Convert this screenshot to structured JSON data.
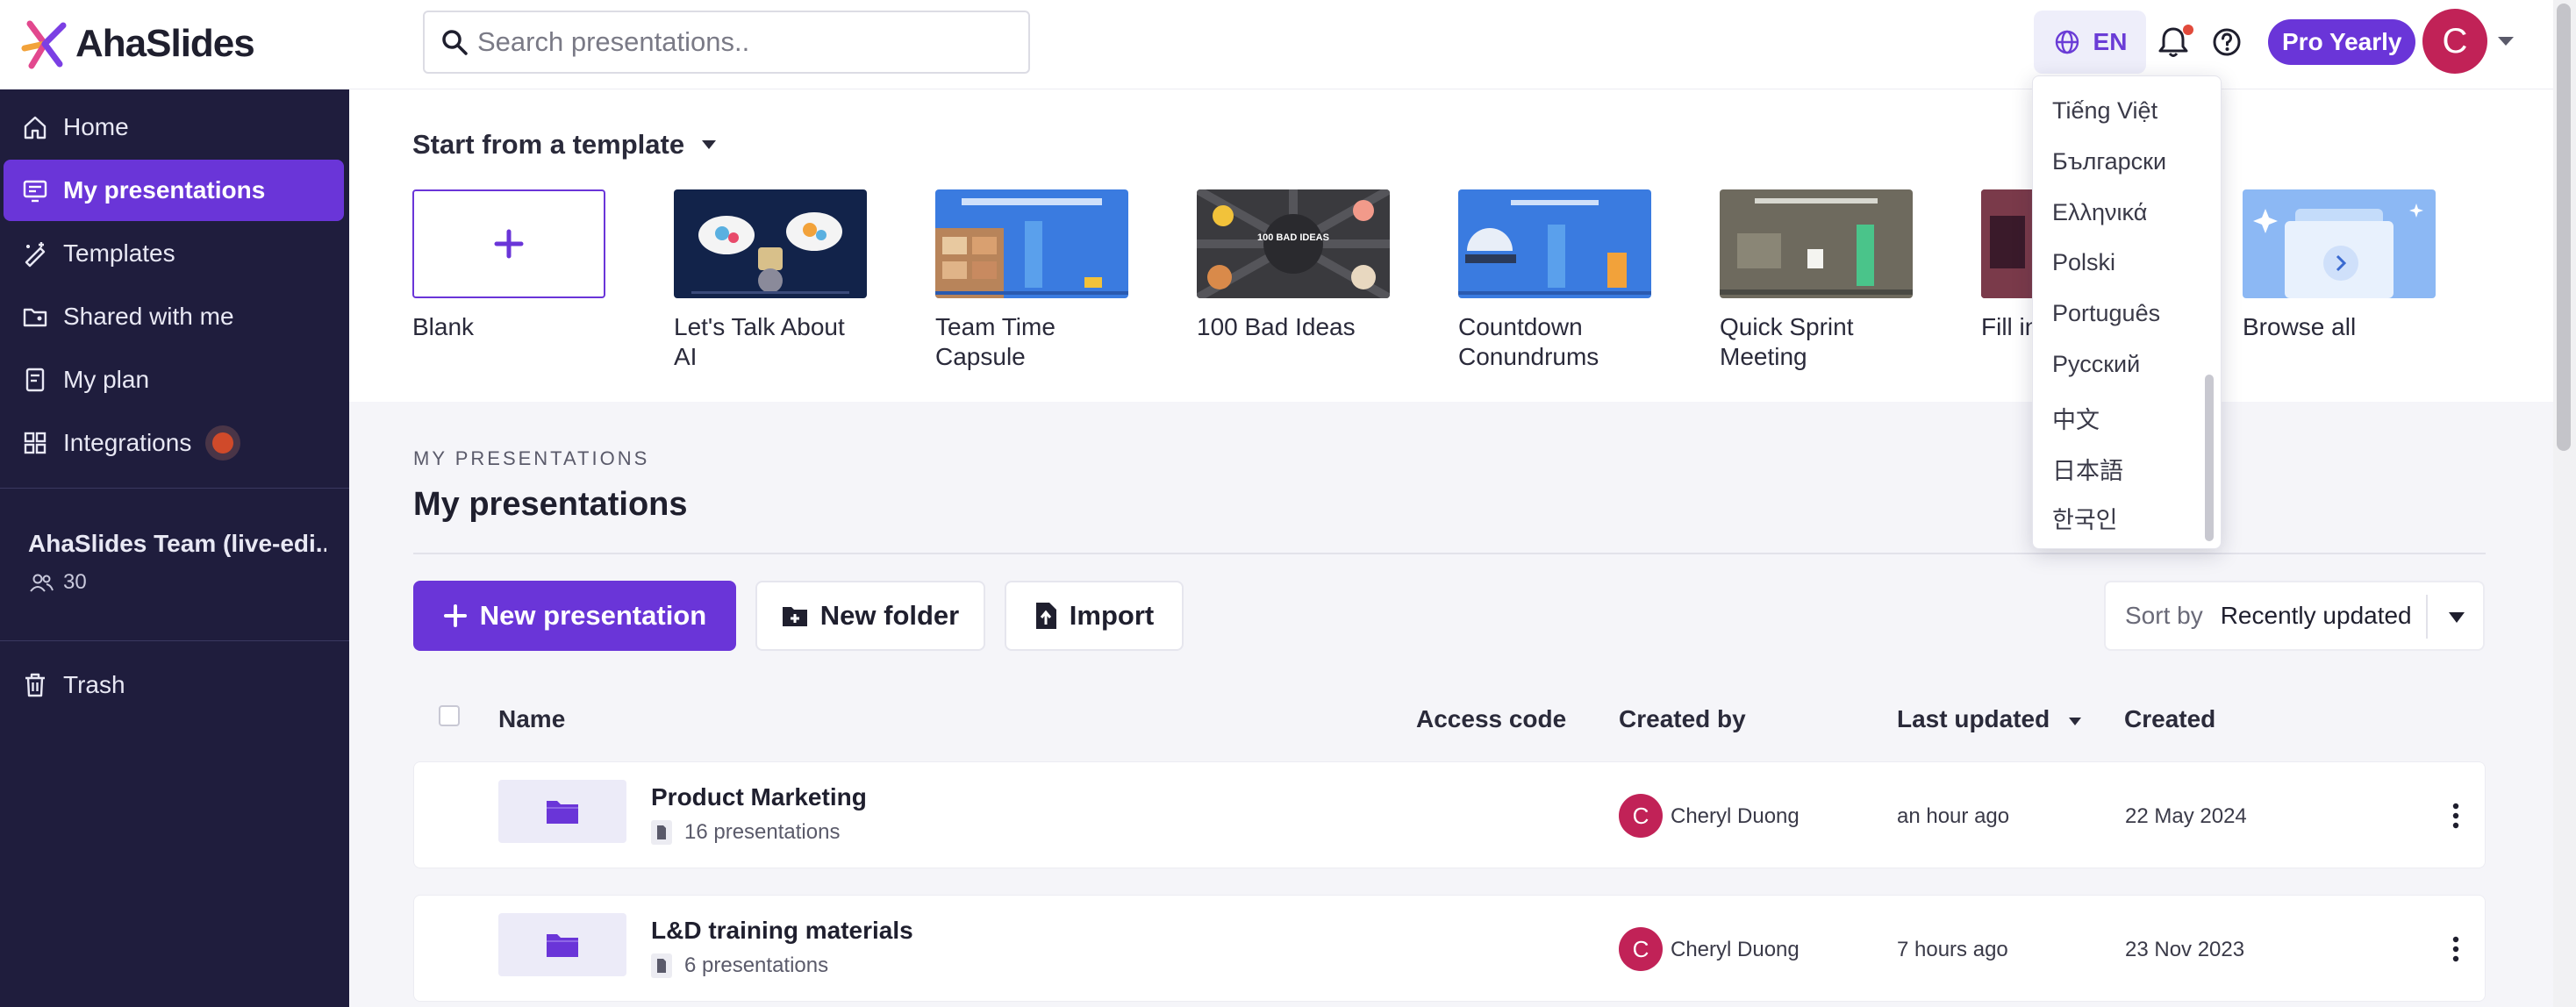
{
  "app": {
    "logo_text": "AhaSlides"
  },
  "search": {
    "placeholder": "Search presentations.."
  },
  "header": {
    "language_code": "EN",
    "plan_badge": "Pro Yearly",
    "avatar_initial": "C",
    "icons": [
      "globe-icon",
      "bell-icon",
      "help-icon",
      "chevron-down-icon"
    ]
  },
  "sidebar": {
    "items": [
      {
        "label": "Home",
        "icon": "home-icon"
      },
      {
        "label": "My presentations",
        "icon": "presentation-icon",
        "active": true
      },
      {
        "label": "Templates",
        "icon": "templates-icon"
      },
      {
        "label": "Shared with me",
        "icon": "shared-folder-icon"
      },
      {
        "label": "My plan",
        "icon": "plan-icon"
      },
      {
        "label": "Integrations",
        "icon": "integrations-icon"
      }
    ],
    "team": {
      "name": "AhaSlides Team (live-edi...",
      "members": "30"
    },
    "trash": {
      "label": "Trash",
      "icon": "trash-icon"
    }
  },
  "templates": {
    "heading": "Start from a template",
    "cards": [
      {
        "label": "Blank"
      },
      {
        "label": "Let's Talk About AI"
      },
      {
        "label": "Team Time Capsule"
      },
      {
        "label": "100 Bad Ideas",
        "thumb_text": "100 BAD IDEAS"
      },
      {
        "label": "Countdown Conundrums"
      },
      {
        "label": "Quick Sprint Meeting"
      },
      {
        "label": "Fill in"
      },
      {
        "label": "Browse all"
      }
    ]
  },
  "main": {
    "eyebrow": "MY PRESENTATIONS",
    "title": "My presentations",
    "buttons": {
      "new_presentation": "New presentation",
      "new_folder": "New folder",
      "import": "Import"
    },
    "sort": {
      "label": "Sort by",
      "value": "Recently updated"
    },
    "columns": {
      "name": "Name",
      "access_code": "Access code",
      "created_by": "Created by",
      "last_updated": "Last updated",
      "created": "Created"
    },
    "rows": [
      {
        "title": "Product Marketing",
        "count": "16 presentations",
        "creator_initial": "C",
        "creator": "Cheryl Duong",
        "updated": "an hour ago",
        "created": "22 May 2024"
      },
      {
        "title": "L&D training materials",
        "count": "6 presentations",
        "creator_initial": "C",
        "creator": "Cheryl Duong",
        "updated": "7 hours ago",
        "created": "23 Nov 2023"
      }
    ]
  },
  "language_menu": {
    "options": [
      "Tiếng Việt",
      "Български",
      "Ελληνικά",
      "Polski",
      "Português",
      "Русский",
      "中文",
      "日本語",
      "한국인"
    ]
  },
  "colors": {
    "brand": "#6a35d8",
    "sidebar_bg": "#1f1d3d",
    "avatar": "#c12257"
  }
}
